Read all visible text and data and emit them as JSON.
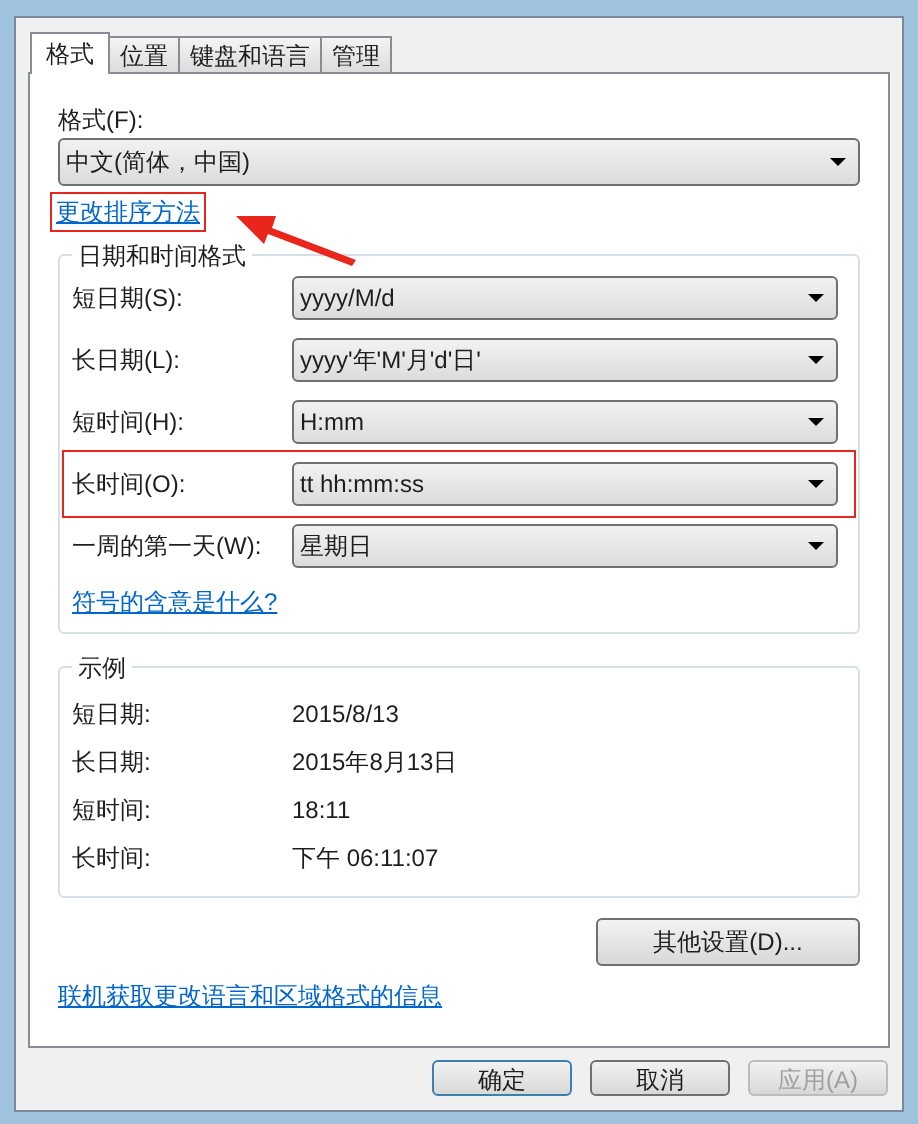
{
  "tabs": [
    {
      "label": "格式",
      "selected": true
    },
    {
      "label": "位置",
      "selected": false
    },
    {
      "label": "键盘和语言",
      "selected": false
    },
    {
      "label": "管理",
      "selected": false
    }
  ],
  "format": {
    "label": "格式(F):",
    "value": "中文(简体，中国)"
  },
  "sort_link": {
    "text": "更改排序方法",
    "highlighted": true
  },
  "date_time_group": {
    "title": "日期和时间格式",
    "rows": [
      {
        "label": "短日期(S):",
        "value": "yyyy/M/d",
        "highlighted": false
      },
      {
        "label": "长日期(L):",
        "value": "yyyy'年'M'月'd'日'",
        "highlighted": false
      },
      {
        "label": "短时间(H):",
        "value": "H:mm",
        "highlighted": false
      },
      {
        "label": "长时间(O):",
        "value": "tt hh:mm:ss",
        "highlighted": true
      },
      {
        "label": "一周的第一天(W):",
        "value": "星期日",
        "highlighted": false
      }
    ],
    "link": "符号的含意是什么?"
  },
  "example_group": {
    "title": "示例",
    "rows": [
      {
        "label": "短日期:",
        "value": "2015/8/13"
      },
      {
        "label": "长日期:",
        "value": "2015年8月13日"
      },
      {
        "label": "短时间:",
        "value": "18:11"
      },
      {
        "label": "长时间:",
        "value": "下午 06:11:07"
      }
    ]
  },
  "other_settings_button": "其他设置(D)...",
  "online_link": "联机获取更改语言和区域格式的信息",
  "buttons": [
    {
      "label": "确定",
      "disabled": false,
      "default": true
    },
    {
      "label": "取消",
      "disabled": false,
      "default": false
    },
    {
      "label": "应用(A)",
      "disabled": true,
      "default": false
    }
  ]
}
